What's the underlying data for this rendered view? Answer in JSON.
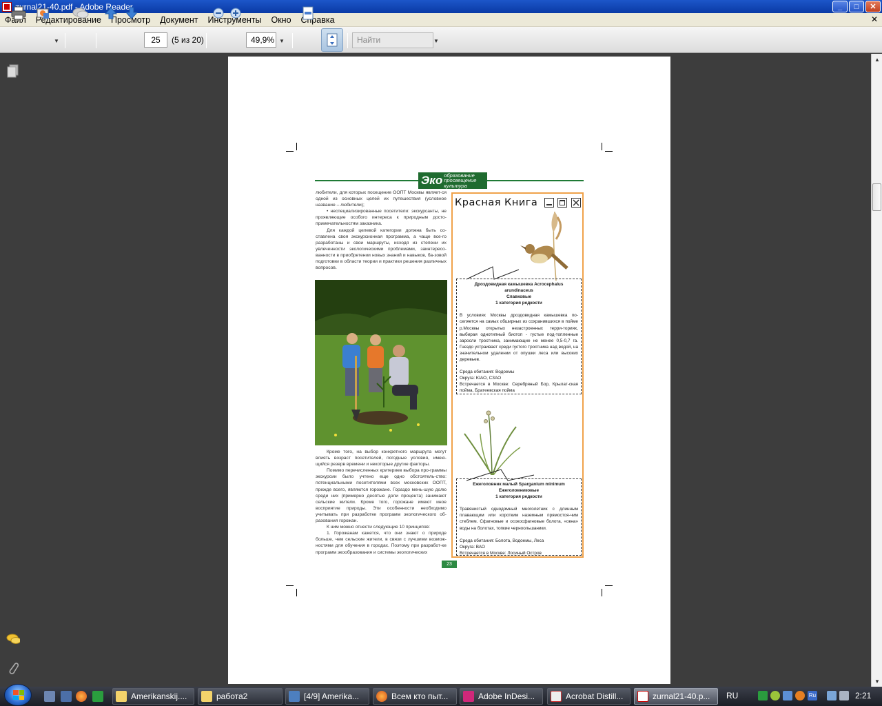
{
  "window": {
    "title": "zurnal21-40.pdf - Adobe Reader"
  },
  "menu": [
    "Файл",
    "Редактирование",
    "Просмотр",
    "Документ",
    "Инструменты",
    "Окно",
    "Справка"
  ],
  "toolbar": {
    "page_value": "25",
    "page_count": "(5 из 20)",
    "zoom_value": "49,9%",
    "find_placeholder": "Найти"
  },
  "page": {
    "logo_main": "Эко",
    "logo_line1": "образование",
    "logo_line2": "просвещение",
    "logo_line3": "культура",
    "page_number": "23",
    "left_top_paragraphs": [
      "любители, для которых посещение ООПТ Москвы являет-ся одной из основных целей их путешествия (условное название – любители);",
      "• неспециализированные посетители: экскурсанты, не проявляющие особого интереса к природным досто-примечательностям заказника.",
      "Для каждой целевой категории должна быть со-ставлена своя экскурсионная программа, а чаще все-го разработаны и свои маршруты, исходя из степени их увлеченности экологическими проблемами, заинтересо-ванности в приобретении новых знаний и навыков, ба-зовой подготовки в области теории и практики решения различных вопросов."
    ],
    "left_bottom_paragraphs": [
      "Кроме того, на выбор конкретного маршрута могут влиять возраст посетителей, погодные условия, имею-щийся резерв времени и некоторые другие факторы.",
      "Помимо перечисленных критериев выбора про-граммы экскурсии было учтено еще одно обстоятель-ство: потенциальными посетителями всех московских ООПТ, прежде всего, являются горожане. Гораздо мень-шую долю среди них (примерно десятые доли процента) занимают сельские жители. Кроме того, горожане имеют иное восприятие природы. Эти особенности необходимо учитывать при разработке программ экологического об-разования горожан.",
      "К ним можно отнести следующие 10 принципов:",
      "1. Горожанам кажется, что они знают о природе больше, чем сельские жители, в связи с лучшими возмож-ностями для обучения в городах. Поэтому при разработ-ке программ экообразования и системы экологических"
    ],
    "redbook": {
      "title": "Красная Книга",
      "species1": {
        "name_line1": "Дроздовидная камышевка Acrocephalus",
        "name_line2": "arundinaceus",
        "family": "Славковые",
        "category": "1 категория редкости",
        "description": "В условиях Москвы дроздовидная камышевка по-селяется на самых обширных из сохранившихся в пойме р.Москвы открытых незастроенных терри-ториях, выбирая однотипный биотоп - густые под-топленные заросли тростника, занимающие не менее 0,5-0,7 га. Гнездо устраивает среди густого тростника над водой, на значительном удалении от опушки леса или высоких деревьев.",
        "habitat": "Среда обитания: Водоемы",
        "district": "Округа: ЮАО, СЗАО",
        "found": "Встречается в Москве: Серебряный Бор, Крылат-ская пойма, Братеевская пойма"
      },
      "species2": {
        "name_line1": "Ежеголовник малый Sparganium minimum",
        "family": "Ежеголовниковые",
        "category": "1 категория редкости",
        "description": "Травянистый однодомный многолетник с длинным плавающим или коротким наземным прямостоя-чим стеблем. Сфагновые и осокосфагновые болота, «окна» воды на болотах, топкие черноольшаники.",
        "habitat": "Среда обитания: Болота, Водоемы, Леса",
        "district": "Округа: ВАО",
        "found": "Встречается в Москве: Лосиный Остров"
      }
    }
  },
  "taskbar": {
    "tasks": [
      "Amerikanskij....",
      "работа2",
      "[4/9] Amerika...",
      "Всем кто пыт...",
      "Adobe InDesi...",
      "Acrobat Distill...",
      "zurnal21-40.p..."
    ],
    "language": "RU",
    "tray_lang_icon": "Ru",
    "clock": "2:21"
  }
}
